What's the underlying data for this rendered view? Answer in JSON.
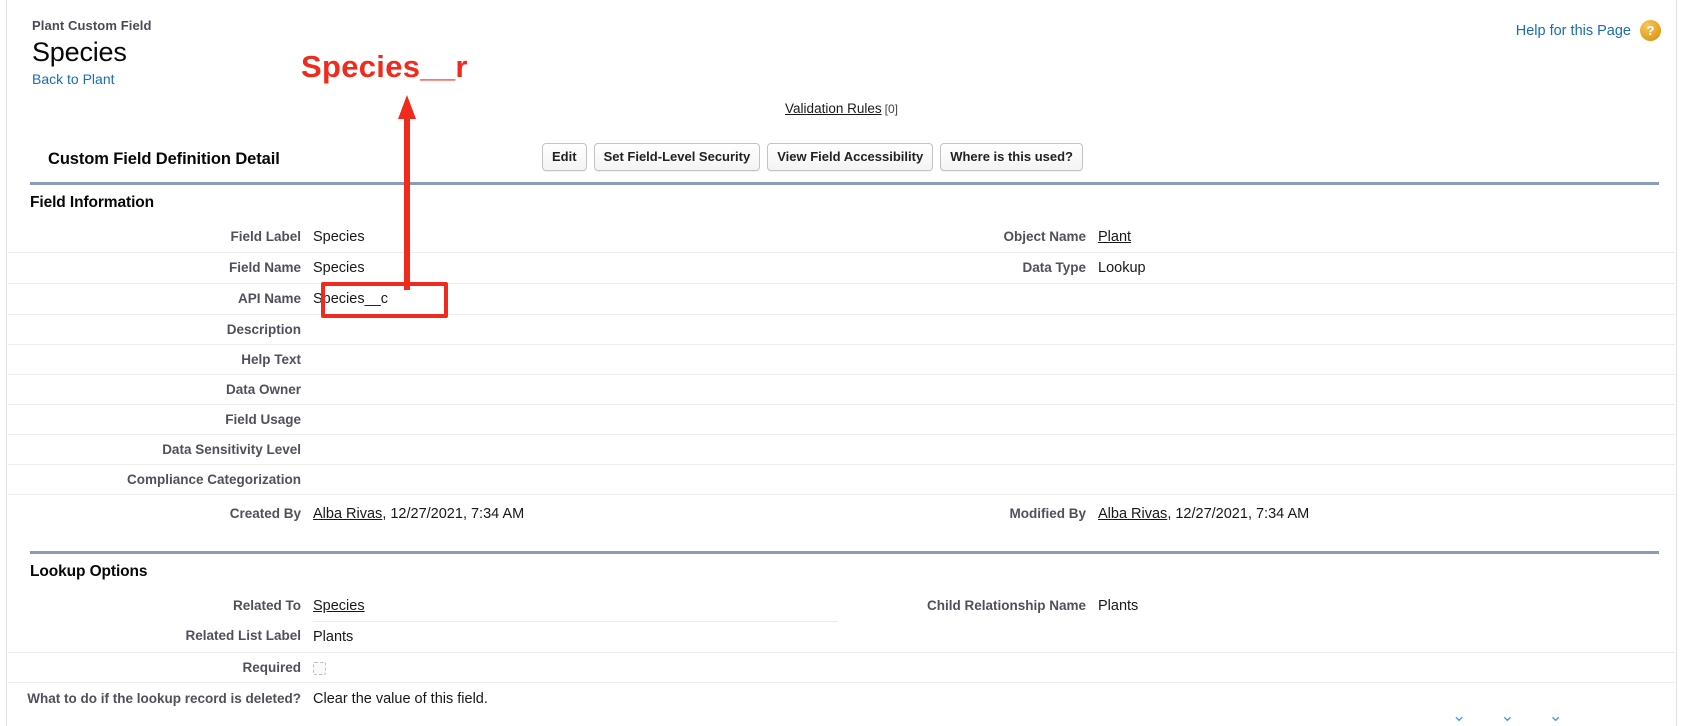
{
  "header": {
    "eyebrow": "Plant Custom Field",
    "title": "Species",
    "back_link": "Back to Plant",
    "help_link": "Help for this Page",
    "help_badge": "?"
  },
  "validation_rules": {
    "label": "Validation Rules",
    "count": "[0]"
  },
  "detail": {
    "title": "Custom Field Definition Detail",
    "buttons": [
      {
        "label": "Edit"
      },
      {
        "label": "Set Field-Level Security"
      },
      {
        "label": "View Field Accessibility"
      },
      {
        "label": "Where is this used?"
      }
    ]
  },
  "field_information": {
    "section_title": "Field Information",
    "rows": [
      {
        "label": "Field Label",
        "value": "Species",
        "link": false,
        "label2": "Object Name",
        "value2": "Plant",
        "link2": true
      },
      {
        "label": "Field Name",
        "value": "Species",
        "link": false,
        "label2": "Data Type",
        "value2": "Lookup",
        "link2": false
      },
      {
        "label": "API Name",
        "value": "Species__c",
        "link": false,
        "label2": "",
        "value2": "",
        "link2": false
      },
      {
        "label": "Description",
        "value": "",
        "link": false,
        "label2": "",
        "value2": "",
        "link2": false
      },
      {
        "label": "Help Text",
        "value": "",
        "link": false,
        "label2": "",
        "value2": "",
        "link2": false
      },
      {
        "label": "Data Owner",
        "value": "",
        "link": false,
        "label2": "",
        "value2": "",
        "link2": false
      },
      {
        "label": "Field Usage",
        "value": "",
        "link": false,
        "label2": "",
        "value2": "",
        "link2": false
      },
      {
        "label": "Data Sensitivity Level",
        "value": "",
        "link": false,
        "label2": "",
        "value2": "",
        "link2": false
      },
      {
        "label": "Compliance Categorization",
        "value": "",
        "link": false,
        "label2": "",
        "value2": "",
        "link2": false
      },
      {
        "label": "Created By",
        "value_link": "Alba Rivas",
        "value_rest": ", 12/27/2021, 7:34 AM",
        "label2": "Modified By",
        "value_link2": "Alba Rivas",
        "value_rest2": ", 12/27/2021, 7:34 AM"
      }
    ]
  },
  "lookup_options": {
    "section_title": "Lookup Options",
    "rows": [
      {
        "label": "Related To",
        "value": "Species",
        "link": true,
        "label2": "Child Relationship Name",
        "value2": "Plants",
        "link2": false
      },
      {
        "label": "Related List Label",
        "value": "Plants",
        "link": false,
        "label2": "",
        "value2": "",
        "link2": false
      },
      {
        "label": "Required",
        "value": "",
        "checkbox": true,
        "label2": "",
        "value2": "",
        "link2": false
      },
      {
        "label": "What to do if the lookup record is deleted?",
        "value": "Clear the value of this field.",
        "link": false,
        "label2": "",
        "value2": "",
        "link2": false
      }
    ]
  },
  "annotation": {
    "text": "Species__r",
    "highlight_target": "Species__c",
    "color": "#f02b1d"
  },
  "colors": {
    "link": "#1a6bb5",
    "section_rule": "#8a9bbd",
    "row_divider": "#eceded",
    "label_text": "#514f5c",
    "annotation_red": "#f02b1d"
  }
}
